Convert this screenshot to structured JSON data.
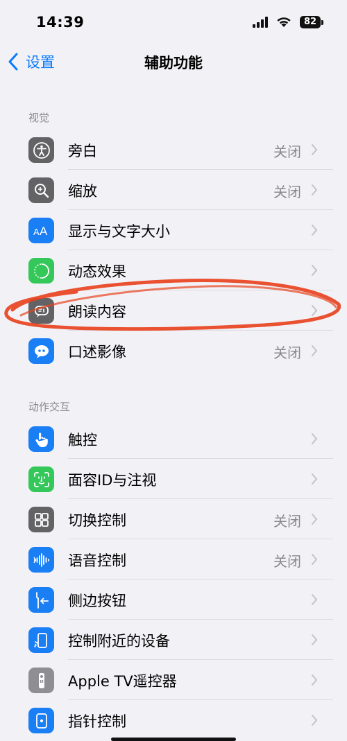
{
  "status_bar": {
    "time": "14:39",
    "battery": "82"
  },
  "nav": {
    "back_label": "设置",
    "title": "辅助功能"
  },
  "sections": [
    {
      "header": "视觉",
      "items": [
        {
          "label": "旁白",
          "value": "关闭",
          "icon": "voiceover-icon",
          "color": "#636366"
        },
        {
          "label": "缩放",
          "value": "关闭",
          "icon": "zoom-icon",
          "color": "#636366"
        },
        {
          "label": "显示与文字大小",
          "value": "",
          "icon": "text-size-icon",
          "color": "#1a7ef5"
        },
        {
          "label": "动态效果",
          "value": "",
          "icon": "motion-icon",
          "color": "#34c759"
        },
        {
          "label": "朗读内容",
          "value": "",
          "icon": "spoken-content-icon",
          "color": "#636366"
        },
        {
          "label": "口述影像",
          "value": "关闭",
          "icon": "audio-description-icon",
          "color": "#1a7ef5"
        }
      ]
    },
    {
      "header": "动作交互",
      "items": [
        {
          "label": "触控",
          "value": "",
          "icon": "touch-icon",
          "color": "#1a7ef5"
        },
        {
          "label": "面容ID与注视",
          "value": "",
          "icon": "face-id-icon",
          "color": "#34c759"
        },
        {
          "label": "切换控制",
          "value": "关闭",
          "icon": "switch-control-icon",
          "color": "#636366"
        },
        {
          "label": "语音控制",
          "value": "关闭",
          "icon": "voice-control-icon",
          "color": "#1a7ef5"
        },
        {
          "label": "侧边按钮",
          "value": "",
          "icon": "side-button-icon",
          "color": "#1a7ef5"
        },
        {
          "label": "控制附近的设备",
          "value": "",
          "icon": "nearby-devices-icon",
          "color": "#1a7ef5"
        },
        {
          "label": "Apple TV遥控器",
          "value": "",
          "icon": "remote-icon",
          "color": "#8e8e93"
        },
        {
          "label": "指针控制",
          "value": "",
          "icon": "pointer-control-icon",
          "color": "#1a7ef5"
        }
      ]
    }
  ],
  "accent_color": "#0a7aff",
  "annotation_color": "#e8431f"
}
